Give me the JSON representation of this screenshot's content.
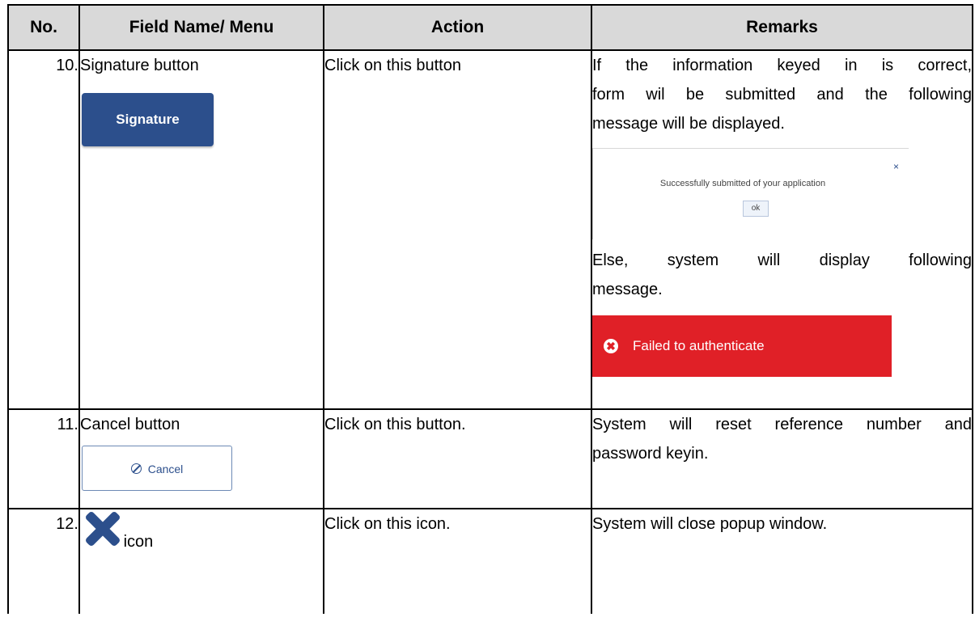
{
  "headers": [
    "No.",
    "Field Name/ Menu",
    "Action",
    "Remarks"
  ],
  "rows": [
    {
      "no": "10.",
      "field": "Signature button",
      "button_label": "Signature",
      "action": "Click on this button",
      "remarks": {
        "line1": "If the information keyed in is correct,",
        "line2": "form wil be submitted and the following",
        "line3": "message will be displayed.",
        "popup_close": "×",
        "popup_message": "Successfully submitted of your application",
        "popup_ok": "ok",
        "line4": "Else, system will display following",
        "line5": "message.",
        "error_icon": "✖",
        "error_text": "Failed to authenticate"
      }
    },
    {
      "no": "11.",
      "field": "Cancel button",
      "button_label": "Cancel",
      "action": "Click on this button.",
      "remarks": {
        "line1": "System will reset reference number and",
        "line2": "password keyin."
      }
    },
    {
      "no": "12.",
      "field": "icon",
      "icon_name": "close-x-icon",
      "action": "Click on this icon.",
      "remarks": {
        "line1": "System will close popup window."
      }
    }
  ],
  "colors": {
    "header_bg": "#d9d9d9",
    "button_blue": "#2c4f8c",
    "error_red": "#e02027"
  }
}
